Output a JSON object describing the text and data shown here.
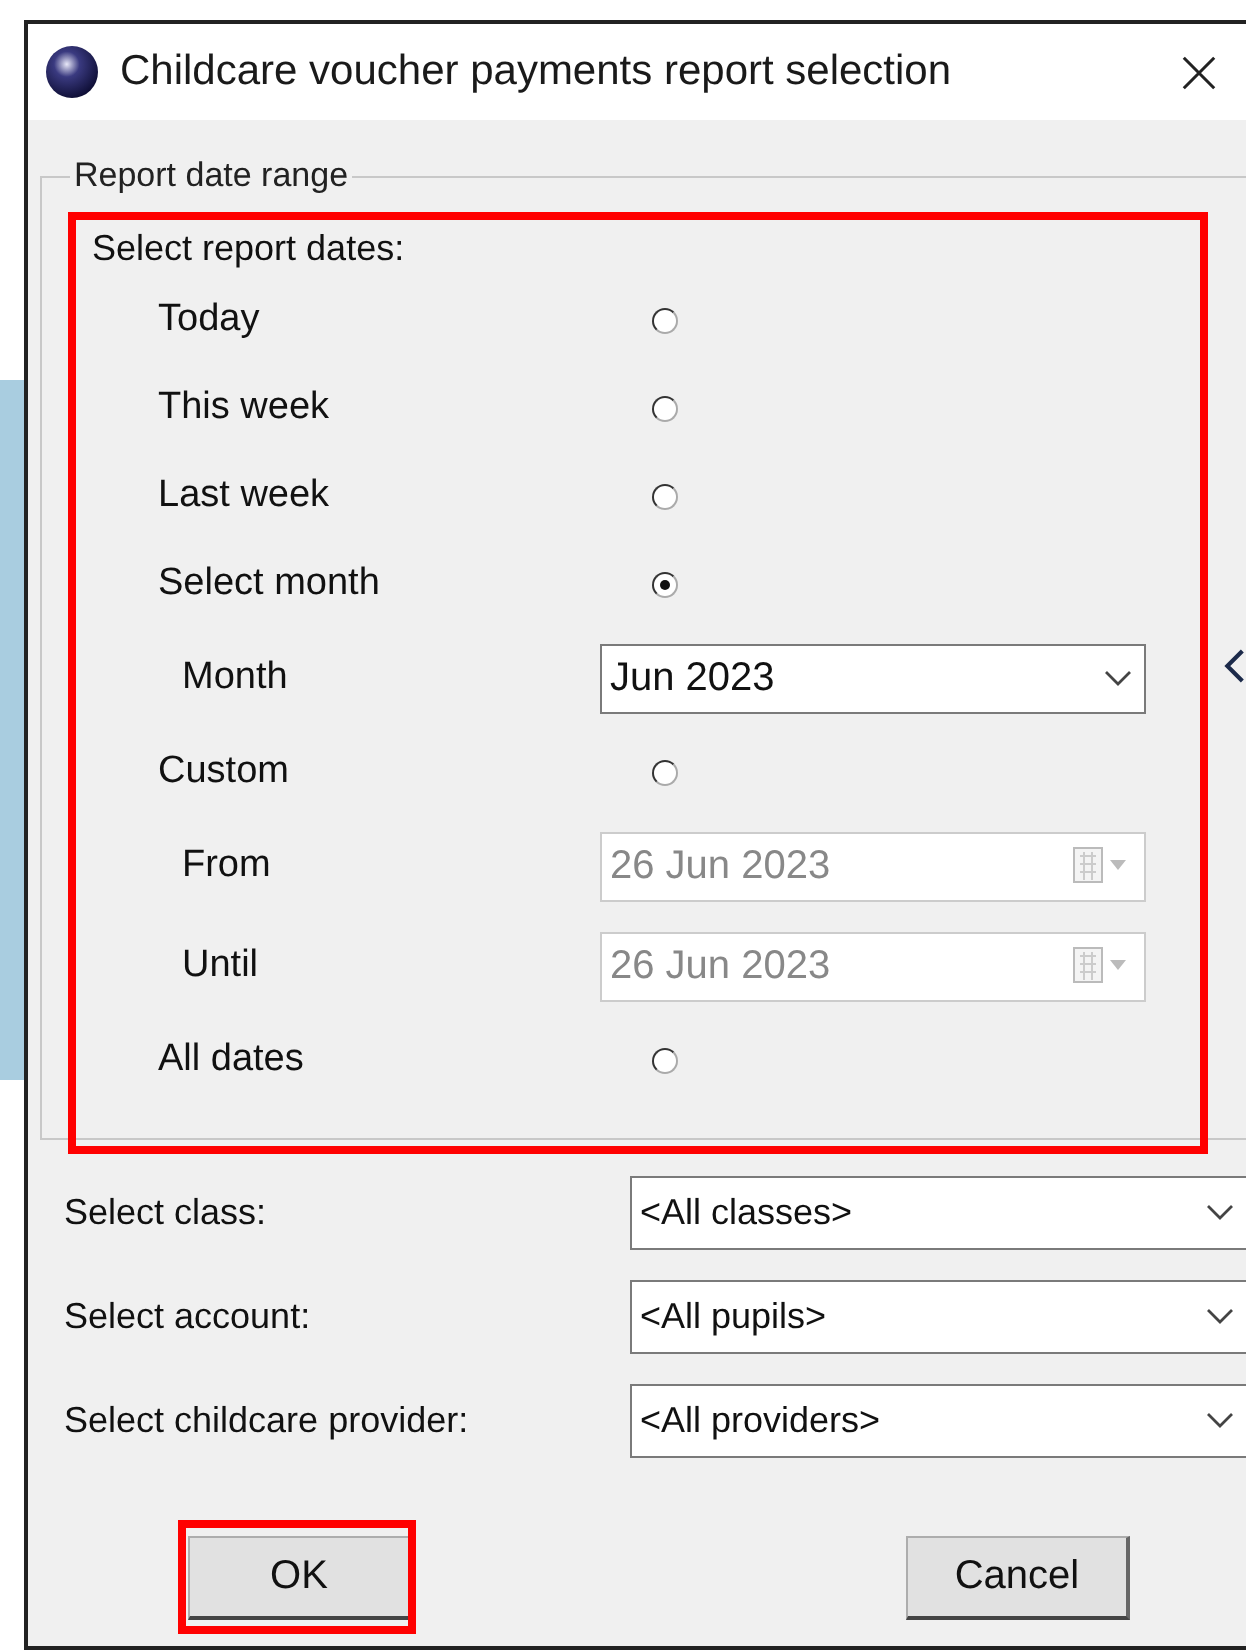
{
  "window": {
    "title": "Childcare voucher payments report selection"
  },
  "date_range": {
    "legend": "Report date range",
    "prompt": "Select report dates:",
    "highlighted": true,
    "options": [
      {
        "kind": "radio",
        "label": "Today",
        "selected": false
      },
      {
        "kind": "radio",
        "label": "This week",
        "selected": false
      },
      {
        "kind": "radio",
        "label": "Last week",
        "selected": false
      },
      {
        "kind": "radio",
        "label": "Select month",
        "selected": true
      },
      {
        "kind": "combo",
        "label": "Month",
        "value": "Jun 2023",
        "disabled": false
      },
      {
        "kind": "radio",
        "label": "Custom",
        "selected": false
      },
      {
        "kind": "date",
        "label": "From",
        "value": "26 Jun  2023",
        "disabled": true
      },
      {
        "kind": "date",
        "label": "Until",
        "value": "26 Jun  2023",
        "disabled": true
      },
      {
        "kind": "radio",
        "label": "All dates",
        "selected": false
      }
    ]
  },
  "filters": [
    {
      "label": "Select class:",
      "value": "<All classes>"
    },
    {
      "label": "Select account:",
      "value": "<All pupils>"
    },
    {
      "label": "Select childcare provider:",
      "value": "<All providers>"
    }
  ],
  "buttons": [
    {
      "label": "OK",
      "highlighted": true
    },
    {
      "label": "Cancel",
      "highlighted": false
    }
  ]
}
